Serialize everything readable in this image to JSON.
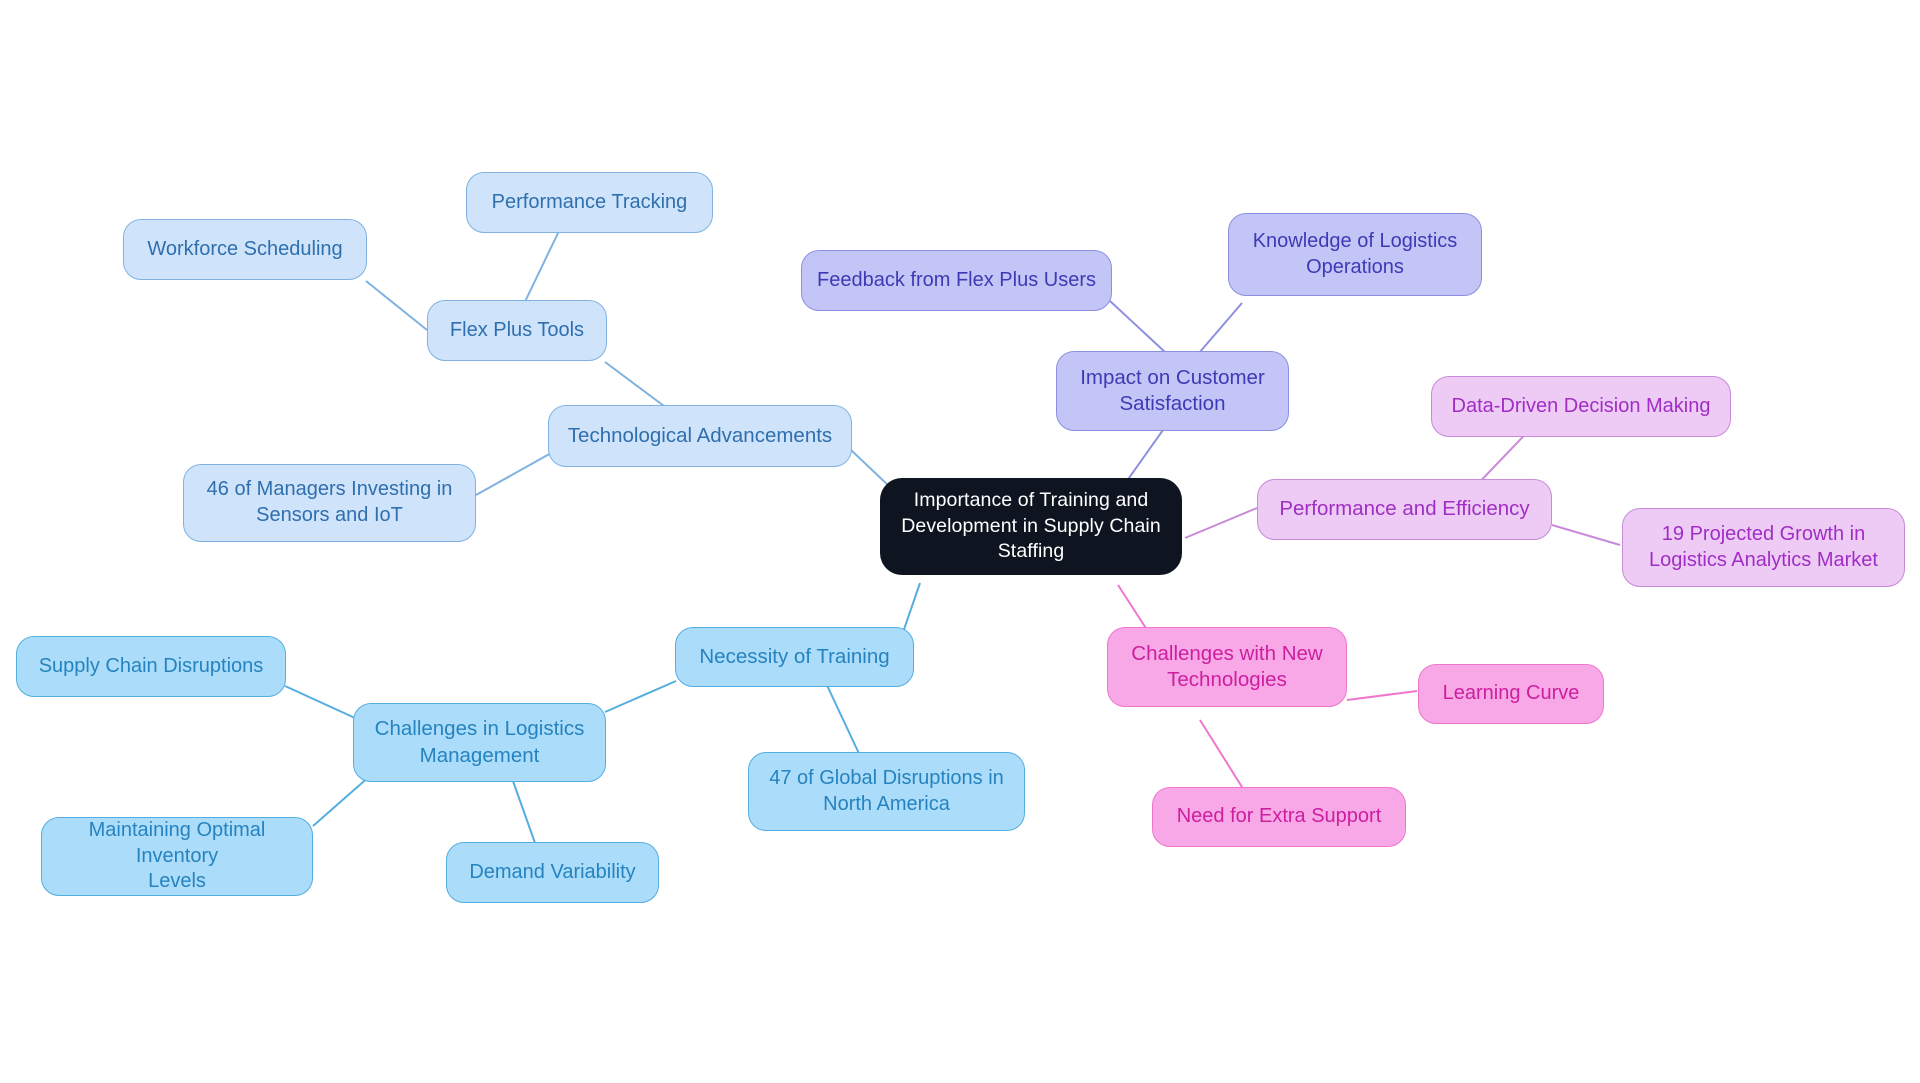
{
  "diagram": {
    "type": "mindmap",
    "title": "Importance of Training and Development in Supply Chain Staffing",
    "background": "#ffffff",
    "root": {
      "id": "root",
      "label": "Importance of Training and Development in Supply Chain Staffing",
      "fill": "#0f1520",
      "text_color": "#ffffff"
    },
    "palette": {
      "blue_fill": "#cfe4fb",
      "blue_border": "#7fb2e0",
      "blue_text": "#2f6fae",
      "cyan_fill": "#abddfa",
      "cyan_border": "#55aee0",
      "cyan_text": "#2683bf",
      "violet_fill": "#c3c5f6",
      "violet_border": "#8d90e0",
      "violet_text": "#3d3ab5",
      "orchid_fill": "#edcbf5",
      "orchid_border": "#c88ad9",
      "orchid_text": "#a02ec4",
      "pink_fill": "#f9a8e7",
      "pink_border": "#ee77cd",
      "pink_text": "#cc1f9e"
    },
    "branches": [
      {
        "id": "tech",
        "label": "Technological Advancements",
        "theme": "blue",
        "children": [
          {
            "id": "flex-plus-tools",
            "label": "Flex Plus Tools",
            "children": [
              {
                "id": "performance-tracking",
                "label": "Performance Tracking"
              },
              {
                "id": "workforce-scheduling",
                "label": "Workforce Scheduling"
              }
            ]
          },
          {
            "id": "managers-sensors-iot",
            "label": "46 of Managers Investing in Sensors and IoT"
          }
        ]
      },
      {
        "id": "necessity",
        "label": "Necessity of Training",
        "theme": "cyan",
        "children": [
          {
            "id": "challenges-logistics",
            "label": "Challenges in Logistics Management",
            "children": [
              {
                "id": "supply-chain-disruptions",
                "label": "Supply Chain Disruptions"
              },
              {
                "id": "maintaining-inventory",
                "label": "Maintaining Optimal Inventory Levels"
              },
              {
                "id": "demand-variability",
                "label": "Demand Variability"
              }
            ]
          },
          {
            "id": "global-disruptions",
            "label": "47 of Global Disruptions in North America"
          }
        ]
      },
      {
        "id": "customer-satisfaction",
        "label": "Impact on Customer Satisfaction",
        "theme": "violet",
        "children": [
          {
            "id": "feedback-flex-plus",
            "label": "Feedback from Flex Plus Users"
          },
          {
            "id": "knowledge-logistics-ops",
            "label": "Knowledge of Logistics Operations"
          }
        ]
      },
      {
        "id": "performance-efficiency",
        "label": "Performance and Efficiency",
        "theme": "orchid",
        "children": [
          {
            "id": "data-driven-decision",
            "label": "Data-Driven Decision Making"
          },
          {
            "id": "projected-growth",
            "label": "19 Projected Growth in Logistics Analytics Market"
          }
        ]
      },
      {
        "id": "challenges-new-tech",
        "label": "Challenges with New Technologies",
        "theme": "pink",
        "children": [
          {
            "id": "learning-curve",
            "label": "Learning Curve"
          },
          {
            "id": "need-extra-support",
            "label": "Need for Extra Support"
          }
        ]
      }
    ],
    "nodes": {
      "root": {
        "label": "Importance of Training and Development in Supply Chain Staffing"
      },
      "performance_tracking": {
        "label": "Performance Tracking"
      },
      "workforce_scheduling": {
        "label": "Workforce Scheduling"
      },
      "flex_plus_tools": {
        "label": "Flex Plus Tools"
      },
      "technological_advancements": {
        "label": "Technological Advancements"
      },
      "managers_sensors_iot": {
        "label": "46 of Managers Investing in\nSensors and IoT"
      },
      "supply_chain_disruptions": {
        "label": "Supply Chain Disruptions"
      },
      "challenges_in_logistics": {
        "label": "Challenges in Logistics\nManagement"
      },
      "maintaining_inventory": {
        "label": "Maintaining Optimal Inventory\nLevels"
      },
      "demand_variability": {
        "label": "Demand Variability"
      },
      "necessity_of_training": {
        "label": "Necessity of Training"
      },
      "global_disruptions": {
        "label": "47 of Global Disruptions in\nNorth America"
      },
      "feedback_flex_plus": {
        "label": "Feedback from Flex Plus Users"
      },
      "knowledge_logistics_ops": {
        "label": "Knowledge of Logistics\nOperations"
      },
      "impact_customer_satisfaction": {
        "label": "Impact on Customer\nSatisfaction"
      },
      "data_driven_decision": {
        "label": "Data-Driven Decision Making"
      },
      "performance_efficiency": {
        "label": "Performance and Efficiency"
      },
      "projected_growth": {
        "label": "19 Projected Growth in\nLogistics Analytics Market"
      },
      "challenges_new_tech": {
        "label": "Challenges with New\nTechnologies"
      },
      "learning_curve": {
        "label": "Learning Curve"
      },
      "need_extra_support": {
        "label": "Need for Extra Support"
      }
    }
  }
}
